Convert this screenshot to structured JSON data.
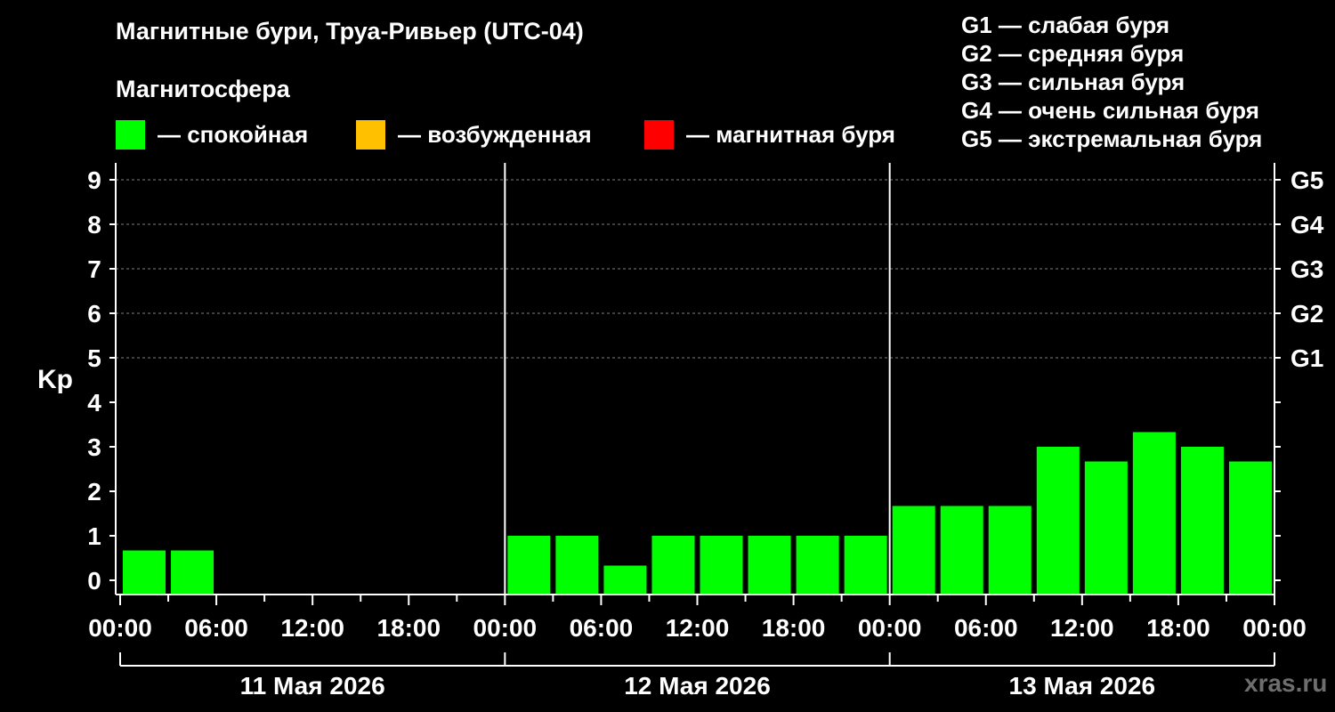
{
  "chart_data": {
    "type": "bar",
    "title": "Магнитные бури, Труа-Ривьер (UTC-04)",
    "subtitle": "Магнитосфера",
    "ylabel": "Kp",
    "ylim": [
      0,
      9
    ],
    "y_ticks": [
      "0",
      "1",
      "2",
      "3",
      "4",
      "5",
      "6",
      "7",
      "8",
      "9"
    ],
    "g_ticks": [
      {
        "kp": 5,
        "label": "G1"
      },
      {
        "kp": 6,
        "label": "G2"
      },
      {
        "kp": 7,
        "label": "G3"
      },
      {
        "kp": 8,
        "label": "G4"
      },
      {
        "kp": 9,
        "label": "G5"
      }
    ],
    "x_tick_labels": [
      "00:00",
      "06:00",
      "12:00",
      "18:00",
      "00:00",
      "06:00",
      "12:00",
      "18:00",
      "00:00",
      "06:00",
      "12:00",
      "18:00",
      "00:00"
    ],
    "days": [
      "11 Мая 2026",
      "12 Мая 2026",
      "13 Мая 2026"
    ],
    "bar_start_hours": [
      0,
      3,
      6,
      9,
      12,
      15,
      18,
      21,
      24,
      27,
      30,
      33,
      36,
      39,
      42,
      45,
      48,
      51,
      54,
      57,
      60,
      63,
      66,
      69
    ],
    "values": [
      0.67,
      0.67,
      null,
      null,
      null,
      null,
      null,
      null,
      1.0,
      1.0,
      0.33,
      1.0,
      1.0,
      1.0,
      1.0,
      1.0,
      1.67,
      1.67,
      1.67,
      3.0,
      2.67,
      3.33,
      3.0,
      2.67
    ],
    "grid": true,
    "legend": {
      "items": [
        {
          "label": "— спокойная",
          "color": "#00ff00"
        },
        {
          "label": "— возбужденная",
          "color": "#ffc000"
        },
        {
          "label": "— магнитная буря",
          "color": "#ff0000"
        }
      ]
    },
    "storm_scale": [
      "G1 — слабая буря",
      "G2 — средняя буря",
      "G3 — сильная буря",
      "G4 — очень сильная буря",
      "G5 — экстремальная буря"
    ],
    "colors": {
      "background": "#000000",
      "quiet": "#00ff00",
      "axis": "#ffffff",
      "grid": "#808080"
    }
  },
  "watermark": "xras.ru"
}
